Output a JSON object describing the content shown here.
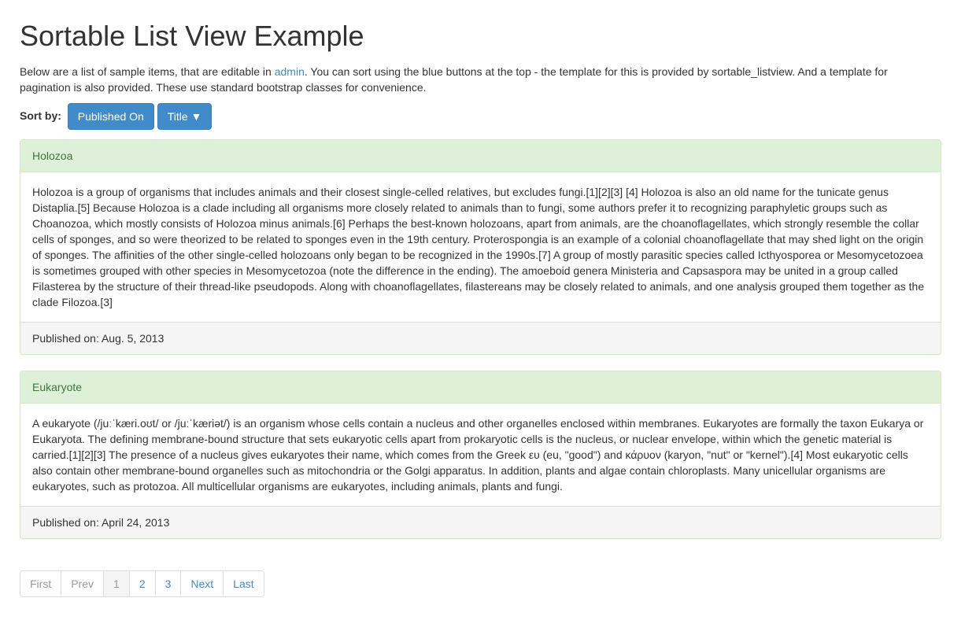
{
  "page": {
    "title": "Sortable List View Example",
    "intro_before": "Below are a list of sample items, that are editable in ",
    "admin_link": "admin",
    "intro_after": ". You can sort using the blue buttons at the top - the template for this is provided by sortable_listview. And a template for pagination is also provided. These use standard bootstrap classes for convenience."
  },
  "sort": {
    "label": "Sort by:",
    "buttons": [
      {
        "label": "Published On"
      },
      {
        "label": "Title ▼"
      }
    ]
  },
  "items": [
    {
      "title": "Holozoa",
      "body": "Holozoa is a group of organisms that includes animals and their closest single-celled relatives, but excludes fungi.[1][2][3] [4] Holozoa is also an old name for the tunicate genus Distaplia.[5] Because Holozoa is a clade including all organisms more closely related to animals than to fungi, some authors prefer it to recognizing paraphyletic groups such as Choanozoa, which mostly consists of Holozoa minus animals.[6] Perhaps the best-known holozoans, apart from animals, are the choanoflagellates, which strongly resemble the collar cells of sponges, and so were theorized to be related to sponges even in the 19th century. Proterospongia is an example of a colonial choanoflagellate that may shed light on the origin of sponges. The affinities of the other single-celled holozoans only began to be recognized in the 1990s.[7] A group of mostly parasitic species called Icthyosporea or Mesomycetozoea is sometimes grouped with other species in Mesomycetozoa (note the difference in the ending). The amoeboid genera Ministeria and Capsaspora may be united in a group called Filasterea by the structure of their thread-like pseudopods. Along with choanoflagellates, filastereans may be closely related to animals, and one analysis grouped them together as the clade Filozoa.[3]",
      "published": "Published on: Aug. 5, 2013"
    },
    {
      "title": "Eukaryote",
      "body": "A eukaryote (/juːˈkæri.oʊt/ or /juːˈkæriət/) is an organism whose cells contain a nucleus and other organelles enclosed within membranes. Eukaryotes are formally the taxon Eukarya or Eukaryota. The defining membrane-bound structure that sets eukaryotic cells apart from prokaryotic cells is the nucleus, or nuclear envelope, within which the genetic material is carried.[1][2][3] The presence of a nucleus gives eukaryotes their name, which comes from the Greek ευ (eu, \"good\") and κάρυον (karyon, \"nut\" or \"kernel\").[4] Most eukaryotic cells also contain other membrane-bound organelles such as mitochondria or the Golgi apparatus. In addition, plants and algae contain chloroplasts. Many unicellular organisms are eukaryotes, such as protozoa. All multicellular organisms are eukaryotes, including animals, plants and fungi.",
      "published": "Published on: April 24, 2013"
    }
  ],
  "pagination": {
    "first": "First",
    "prev": "Prev",
    "pages": [
      "1",
      "2",
      "3"
    ],
    "active_index": 0,
    "next": "Next",
    "last": "Last"
  }
}
